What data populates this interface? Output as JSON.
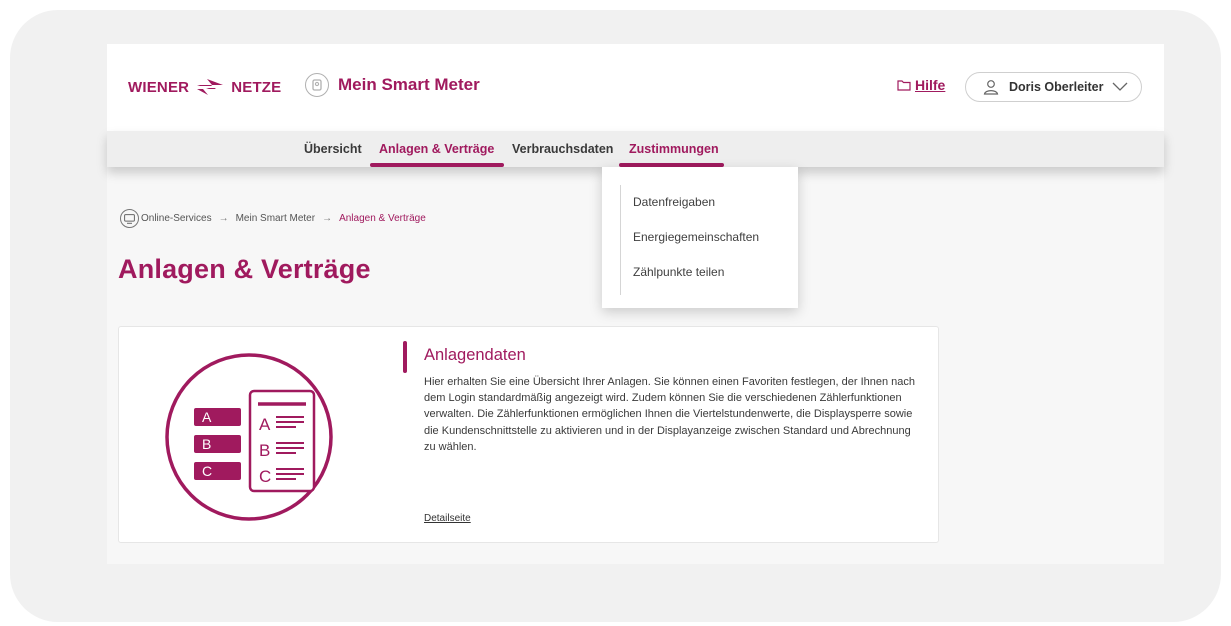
{
  "brand": {
    "logo_left": "WIENER",
    "logo_right": "NETZE",
    "app_name": "Mein Smart Meter",
    "accent_color": "#a01a5e"
  },
  "header": {
    "help_label": "Hilfe",
    "user_name": "Doris Oberleiter"
  },
  "nav": {
    "items": [
      {
        "label": "Übersicht"
      },
      {
        "label": "Anlagen & Verträge"
      },
      {
        "label": "Verbrauchsdaten"
      },
      {
        "label": "Zustimmungen"
      }
    ]
  },
  "dropdown": {
    "items": [
      {
        "label": "Datenfreigaben"
      },
      {
        "label": "Energiegemeinschaften"
      },
      {
        "label": "Zählpunkte teilen"
      }
    ]
  },
  "breadcrumb": {
    "items": [
      "Online-Services",
      "Mein Smart Meter",
      "Anlagen & Verträge"
    ]
  },
  "page": {
    "title": "Anlagen & Verträge"
  },
  "card": {
    "title": "Anlagendaten",
    "description": "Hier erhalten Sie eine Übersicht Ihrer Anlagen. Sie können einen Favoriten festlegen, der Ihnen nach dem Login standardmäßig angezeigt wird. Zudem können Sie die verschiedenen Zählerfunktionen verwalten. Die Zählerfunktionen ermöglichen Ihnen die Viertelstundenwerte, die Displaysperre sowie die Kundenschnittstelle zu aktivieren und in der Displayanzeige zwischen Standard und Abrechnung zu wählen.",
    "link_label": "Detailseite",
    "illustration_letters": [
      "A",
      "B",
      "C"
    ]
  }
}
